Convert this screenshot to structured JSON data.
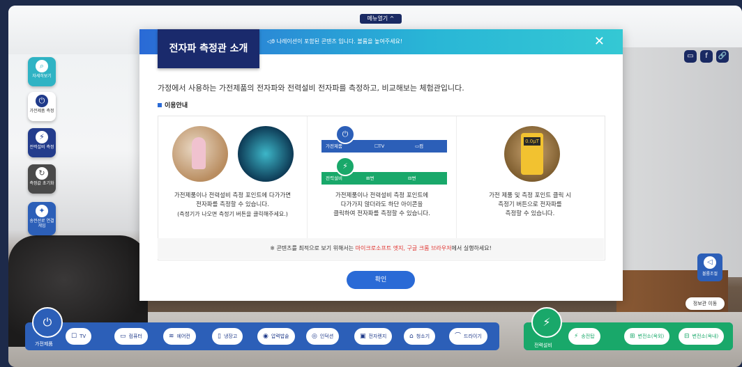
{
  "menu_toggle": "메뉴열기 ^",
  "sidebar": {
    "items": [
      {
        "label": "자세히보기",
        "icon": "search-icon"
      },
      {
        "label": "가전제품 측정",
        "icon": "plug-icon"
      },
      {
        "label": "전력설비 측정",
        "icon": "tower-icon"
      },
      {
        "label": "측정값 초기화",
        "icon": "reset-icon"
      },
      {
        "label": "송전선로 연결게임",
        "icon": "game-icon"
      }
    ]
  },
  "share": {
    "chat": "▭",
    "facebook": "f",
    "link": "🔗"
  },
  "modal": {
    "title": "전자파 측정관 소개",
    "narration_note": "◁ϑ 나레이션이 포함된 콘텐츠 입니다. 볼륨을 높여주세요!",
    "close": "✕",
    "intro": "가정에서 사용하는 가전제품의 전자파와 전력설비 전자파를 측정하고, 비교해보는 체험관입니다.",
    "guide_title": "이용안내",
    "columns": [
      {
        "line1": "가전제품이나 전력설비 측정 포인트에 다가가면",
        "line2": "전자파를 측정할 수 있습니다.",
        "line3": "(측정기가 나오면 측정기 버튼을 클릭해주세요.)"
      },
      {
        "line1": "가전제품이나 전력설비 측정 포인트에",
        "line2": "다가가지 않더라도 하단 아이콘을",
        "line3": "클릭하여 전자파를 측정할 수 있습니다."
      },
      {
        "line1": "가전 제품 및 측정 포인트 클릭 시",
        "line2": "측정기 버튼으로 전자파를",
        "line3": "측정할 수 있습니다."
      }
    ],
    "diagram": {
      "row1": {
        "badge": "가전제품",
        "items": [
          "TV",
          "컴퓨터"
        ]
      },
      "row2": {
        "badge": "전력설비",
        "items": [
          "변전소(옥외)",
          "변전소(옥내)"
        ]
      }
    },
    "meter_reading": "0.0μT",
    "footer_prefix": "※ 콘텐츠를 최적으로 보기 위해서는 ",
    "footer_highlight": "마이크로소프트 엣지, 구글 크롬 브라우저",
    "footer_suffix": "에서 실행하세요!",
    "confirm": "확인"
  },
  "bottom_left": {
    "caption": "가전제품",
    "items": [
      {
        "label": "TV",
        "icon": "tv-icon"
      },
      {
        "label": "컴퓨터",
        "icon": "computer-icon"
      },
      {
        "label": "에어컨",
        "icon": "aircon-icon"
      },
      {
        "label": "냉장고",
        "icon": "fridge-icon"
      },
      {
        "label": "압력밥솥",
        "icon": "ricecooker-icon"
      },
      {
        "label": "인덕션",
        "icon": "induction-icon"
      },
      {
        "label": "전자렌지",
        "icon": "microwave-icon"
      },
      {
        "label": "청소기",
        "icon": "vacuum-icon"
      },
      {
        "label": "드라이기",
        "icon": "dryer-icon"
      }
    ]
  },
  "bottom_right": {
    "caption": "전력설비",
    "items": [
      {
        "label": "송전탑",
        "icon": "tower-icon"
      },
      {
        "label": "변전소(옥외)",
        "icon": "substation-outdoor-icon"
      },
      {
        "label": "변전소(옥내)",
        "icon": "substation-indoor-icon"
      }
    ]
  },
  "volume": "볼륨조절",
  "info_move": "정보관 이동"
}
